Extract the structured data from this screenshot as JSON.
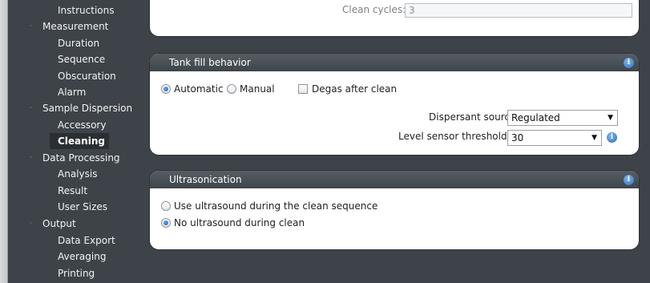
{
  "sidebar": {
    "items": [
      {
        "label": "Instructions",
        "level": "child"
      },
      {
        "label": "Measurement",
        "level": "parent"
      },
      {
        "label": "Duration",
        "level": "child"
      },
      {
        "label": "Sequence",
        "level": "child"
      },
      {
        "label": "Obscuration",
        "level": "child"
      },
      {
        "label": "Alarm",
        "level": "child"
      },
      {
        "label": "Sample Dispersion",
        "level": "parent"
      },
      {
        "label": "Accessory",
        "level": "child"
      },
      {
        "label": "Cleaning",
        "level": "child",
        "selected": true
      },
      {
        "label": "Data Processing",
        "level": "parent"
      },
      {
        "label": "Analysis",
        "level": "child"
      },
      {
        "label": "Result",
        "level": "child"
      },
      {
        "label": "User Sizes",
        "level": "child"
      },
      {
        "label": "Output",
        "level": "parent"
      },
      {
        "label": "Data Export",
        "level": "child"
      },
      {
        "label": "Averaging",
        "level": "child"
      },
      {
        "label": "Printing",
        "level": "child"
      }
    ]
  },
  "clean_cycles": {
    "label": "Clean cycles:",
    "value": "3"
  },
  "tank_fill": {
    "title": "Tank fill behavior",
    "automatic_label": "Automatic",
    "manual_label": "Manual",
    "degas_label": "Degas after clean",
    "dispersant_label": "Dispersant source:",
    "dispersant_value": "Regulated",
    "level_label": "Level sensor threshold:",
    "level_value": "30"
  },
  "ultrasonication": {
    "title": "Ultrasonication",
    "option_use": "Use ultrasound during the clean sequence",
    "option_none": "No ultrasound during clean"
  },
  "icons": {
    "info": "i",
    "dropdown": "▼",
    "bullet": "·"
  },
  "colors": {
    "sidebar_bg": "#3d4348",
    "card_header": "#4a5157",
    "info_blue": "#2d6fc4"
  }
}
